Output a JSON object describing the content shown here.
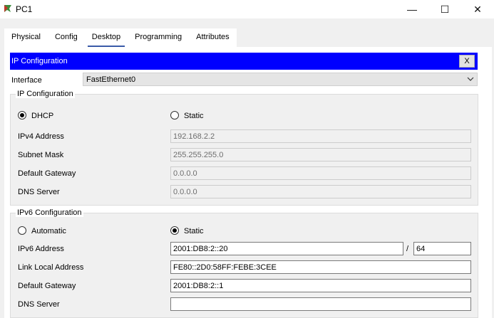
{
  "window": {
    "title": "PC1"
  },
  "controls": {
    "minimize": "—",
    "maximize": "☐",
    "close": "✕"
  },
  "tabs": [
    "Physical",
    "Config",
    "Desktop",
    "Programming",
    "Attributes"
  ],
  "active_tab": "Desktop",
  "app": {
    "title": "IP Configuration",
    "close_label": "X"
  },
  "interface": {
    "label": "Interface",
    "value": "FastEthernet0"
  },
  "ipv4": {
    "group_label": "IP Configuration",
    "dhcp_label": "DHCP",
    "static_label": "Static",
    "selected": "DHCP",
    "address_label": "IPv4 Address",
    "address": "192.168.2.2",
    "mask_label": "Subnet Mask",
    "mask": "255.255.255.0",
    "gateway_label": "Default Gateway",
    "gateway": "0.0.0.0",
    "dns_label": "DNS Server",
    "dns": "0.0.0.0"
  },
  "ipv6": {
    "group_label": "IPv6 Configuration",
    "auto_label": "Automatic",
    "static_label": "Static",
    "selected": "Static",
    "address_label": "IPv6 Address",
    "address": "2001:DB8:2::20",
    "slash": "/",
    "prefix": "64",
    "link_local_label": "Link Local Address",
    "link_local": "FE80::2D0:58FF:FEBE:3CEE",
    "gateway_label": "Default Gateway",
    "gateway": "2001:DB8:2::1",
    "dns_label": "DNS Server",
    "dns": ""
  },
  "colors": {
    "title_bar": "#0000ff",
    "panel_bg": "#f0f0f0"
  }
}
